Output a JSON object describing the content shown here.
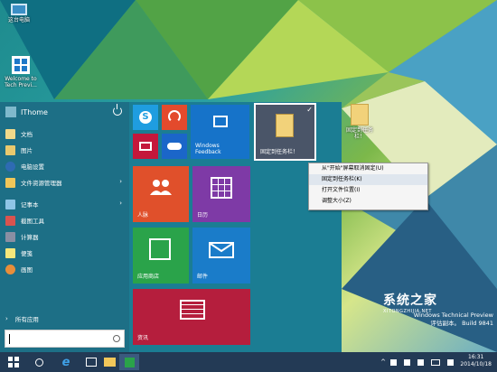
{
  "desktop": {
    "icons": [
      {
        "name": "this-pc",
        "label": "这台电脑"
      },
      {
        "name": "welcome",
        "label": "Welcome to Tech Previ..."
      },
      {
        "name": "folder",
        "label": "固定到任务栏！"
      }
    ]
  },
  "start_menu": {
    "user_name": "IThome",
    "items": [
      {
        "label": "文档",
        "icon": "documents-icon",
        "has_arrow": false
      },
      {
        "label": "图片",
        "icon": "pictures-icon",
        "has_arrow": false
      },
      {
        "label": "电脑设置",
        "icon": "pc-settings-icon",
        "has_arrow": false
      },
      {
        "label": "文件资源管理器",
        "icon": "file-explorer-icon",
        "has_arrow": true
      },
      {
        "label": "记事本",
        "icon": "notepad-icon",
        "has_arrow": true
      },
      {
        "label": "截图工具",
        "icon": "snipping-tool-icon",
        "has_arrow": false
      },
      {
        "label": "计算器",
        "icon": "calculator-icon",
        "has_arrow": false
      },
      {
        "label": "便笺",
        "icon": "sticky-notes-icon",
        "has_arrow": false
      },
      {
        "label": "画图",
        "icon": "paint-icon",
        "has_arrow": false
      }
    ],
    "all_apps": "所有应用",
    "tiles": {
      "windows_feedback": "Windows Feedback",
      "pinned_folder": "固定到任务栏！",
      "people": "人脉",
      "calendar": "日历",
      "store": "应用商店",
      "mail": "邮件",
      "news": "资讯"
    }
  },
  "context_menu": {
    "items": [
      "从\"开始\"屏幕取消固定(U)",
      "固定到任务栏(K)",
      "打开文件位置(I)",
      "调整大小(Z)"
    ],
    "highlighted": 1
  },
  "branding": {
    "watermark_line1": "Windows Technical Preview",
    "watermark_line2": "评估副本。 Build 9841",
    "site_cn": "系统之家",
    "site_en": "XITONGZHIJIA.NET"
  },
  "taskbar": {
    "time": "16:31",
    "date": "2014/10/18"
  }
}
